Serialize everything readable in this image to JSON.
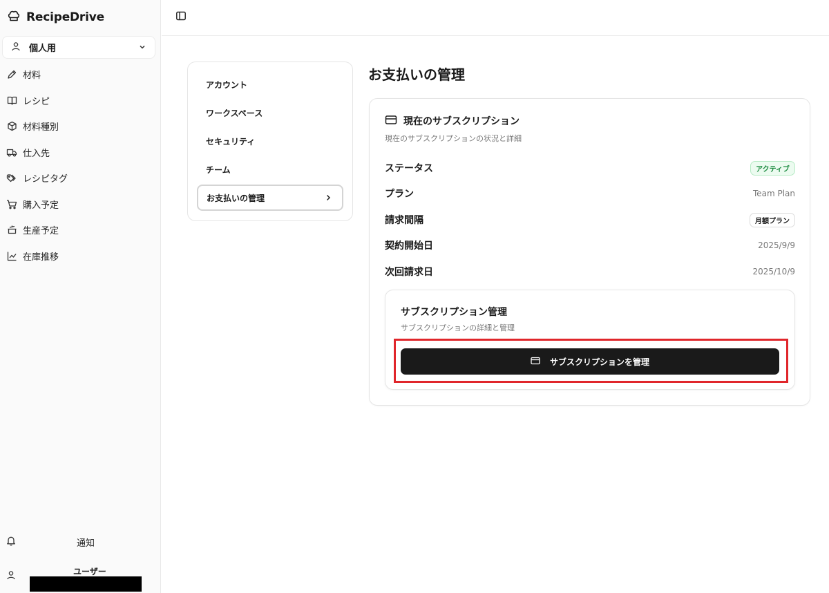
{
  "app": {
    "name": "RecipeDrive"
  },
  "workspace": {
    "label": "個人用"
  },
  "sidebar": {
    "items": [
      {
        "label": "材料",
        "icon": "pen-icon"
      },
      {
        "label": "レシピ",
        "icon": "book-icon"
      },
      {
        "label": "材料種別",
        "icon": "box-icon"
      },
      {
        "label": "仕入先",
        "icon": "truck-icon"
      },
      {
        "label": "レシピタグ",
        "icon": "tag-icon"
      },
      {
        "label": "購入予定",
        "icon": "cart-icon"
      },
      {
        "label": "生産予定",
        "icon": "pot-icon"
      },
      {
        "label": "在庫推移",
        "icon": "chart-line-icon"
      }
    ],
    "notifications_label": "通知",
    "user_label": "ユーザー"
  },
  "settings_menu": {
    "items": [
      {
        "label": "アカウント"
      },
      {
        "label": "ワークスペース"
      },
      {
        "label": "セキュリティ"
      },
      {
        "label": "チーム"
      },
      {
        "label": "お支払いの管理",
        "active": true
      }
    ]
  },
  "main": {
    "title": "お支払いの管理",
    "subscription": {
      "title": "現在のサブスクリプション",
      "description": "現在のサブスクリプションの状況と詳細",
      "rows": {
        "status": {
          "label": "ステータス",
          "value": "アクティブ"
        },
        "plan": {
          "label": "プラン",
          "value": "Team Plan"
        },
        "interval": {
          "label": "請求間隔",
          "value": "月額プラン"
        },
        "start": {
          "label": "契約開始日",
          "value": "2025/9/9"
        },
        "next": {
          "label": "次回請求日",
          "value": "2025/10/9"
        }
      },
      "management": {
        "title": "サブスクリプション管理",
        "description": "サブスクリプションの詳細と管理",
        "button_label": "サブスクリプションを管理"
      }
    }
  },
  "colors": {
    "highlight": "#e0262b",
    "button_bg": "#1a1a1a",
    "active_badge": "#1a8a3e"
  }
}
